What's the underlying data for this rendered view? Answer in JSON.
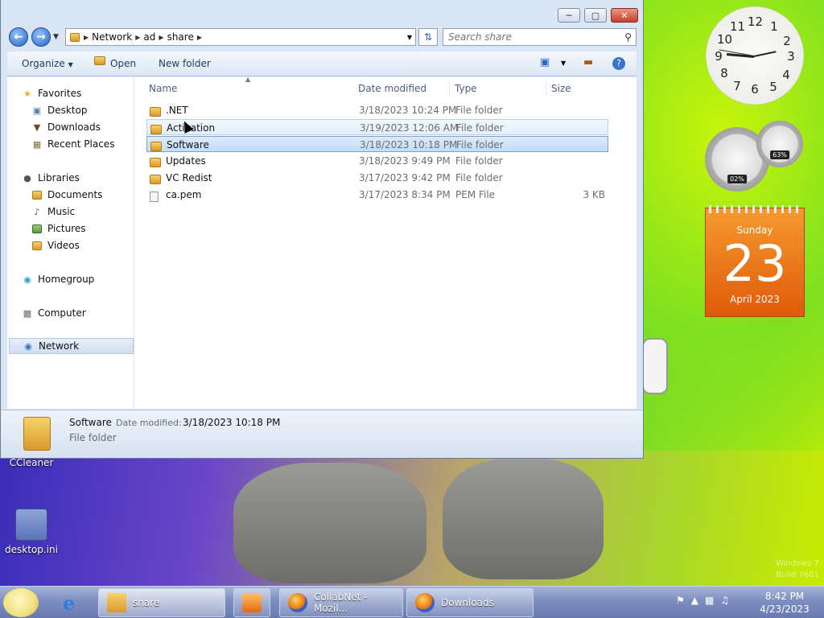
{
  "window": {
    "address": {
      "segments": [
        "Network",
        "ad",
        "share"
      ]
    },
    "search": {
      "placeholder": "Search share"
    },
    "toolbar": {
      "organize": "Organize",
      "open": "Open",
      "new_folder": "New folder"
    },
    "nav": {
      "favorites": "Favorites",
      "desktop": "Desktop",
      "downloads": "Downloads",
      "recent_places": "Recent Places",
      "libraries": "Libraries",
      "documents": "Documents",
      "music": "Music",
      "pictures": "Pictures",
      "videos": "Videos",
      "homegroup": "Homegroup",
      "computer": "Computer",
      "network": "Network"
    },
    "columns": {
      "name": "Name",
      "date": "Date modified",
      "type": "Type",
      "size": "Size"
    },
    "files": [
      {
        "name": ".NET",
        "date": "3/18/2023 10:24 PM",
        "type": "File folder",
        "size": ""
      },
      {
        "name": "Activation",
        "date": "3/19/2023 12:06 AM",
        "type": "File folder",
        "size": ""
      },
      {
        "name": "Software",
        "date": "3/18/2023 10:18 PM",
        "type": "File folder",
        "size": ""
      },
      {
        "name": "Updates",
        "date": "3/18/2023 9:49 PM",
        "type": "File folder",
        "size": ""
      },
      {
        "name": "VC Redist",
        "date": "3/17/2023 9:42 PM",
        "type": "File folder",
        "size": ""
      },
      {
        "name": "ca.pem",
        "date": "3/17/2023 8:34 PM",
        "type": "PEM File",
        "size": "3 KB"
      }
    ],
    "details": {
      "name": "Software",
      "date_label": "Date modified:",
      "date": "3/18/2023 10:18 PM",
      "type": "File folder"
    }
  },
  "desktop": {
    "icons": {
      "ccleaner": "CCleaner",
      "desktop_ini": "desktop.ini"
    },
    "watermark": {
      "line1": "Windows 7",
      "line2": "Build 7601"
    }
  },
  "gadgets": {
    "clock_numbers": [
      "12",
      "1",
      "2",
      "3",
      "4",
      "5",
      "6",
      "7",
      "8",
      "9",
      "10",
      "11"
    ],
    "cpu": "02%",
    "memory": "63%",
    "calendar": {
      "day_name": "Sunday",
      "day": "23",
      "month_year": "April 2023"
    }
  },
  "taskbar": {
    "share": "share",
    "collabnet": "CollabNet - Mozil...",
    "downloads": "Downloads",
    "time": "8:42 PM",
    "date": "4/23/2023"
  }
}
